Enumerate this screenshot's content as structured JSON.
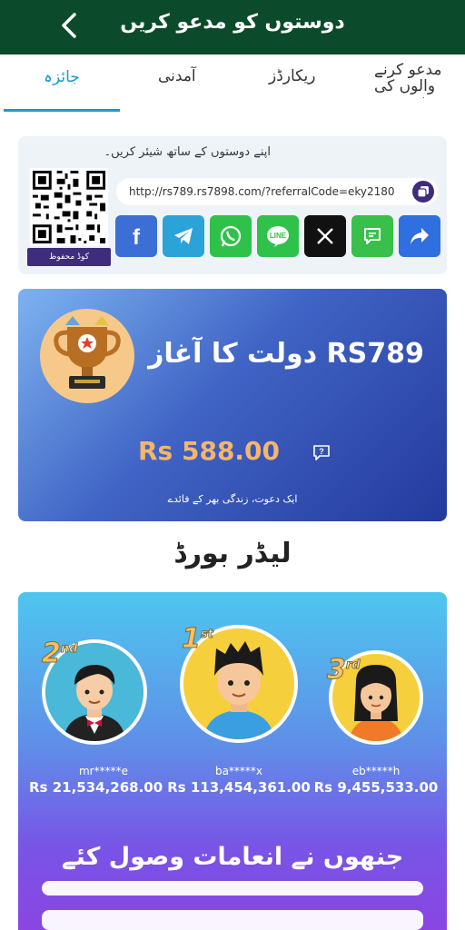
{
  "header": {
    "title": "دوستوں کو مدعو کریں"
  },
  "tabs": [
    {
      "label": "جائزہ"
    },
    {
      "label": "آمدنی"
    },
    {
      "label": "ریکارڈز"
    },
    {
      "label": "مدعو کرنے والوں کی فہرست"
    }
  ],
  "share": {
    "prompt": "اپنے دوستوں کے ساتھ شیئر کریں۔",
    "save_code_label": "کوڈ محفوظ",
    "url": "http://rs789.rs7898.com/?referralCode=eky2180",
    "socials": [
      {
        "name": "facebook",
        "color": "#3b6fd6"
      },
      {
        "name": "telegram",
        "color": "#2aa3d9"
      },
      {
        "name": "whatsapp",
        "color": "#2fc24b"
      },
      {
        "name": "line",
        "color": "#2fc24b"
      },
      {
        "name": "x",
        "color": "#111111"
      },
      {
        "name": "sms",
        "color": "#38c04a"
      },
      {
        "name": "share",
        "color": "#2f6fe0"
      }
    ]
  },
  "promo": {
    "title": "دولت کا آغاز RS789",
    "amount": "Rs  588.00",
    "subtitle": "ایک دعوت، زندگی بھر کے فائدے"
  },
  "leaderboard": {
    "title": "لیڈر بورڈ",
    "entries": [
      {
        "rank": "2",
        "suffix": "nd",
        "name": "mr*****e",
        "amount": "Rs  21,534,268.00"
      },
      {
        "rank": "1",
        "suffix": "st",
        "name": "ba*****x",
        "amount": "Rs  113,454,361.00"
      },
      {
        "rank": "3",
        "suffix": "rd",
        "name": "eb*****h",
        "amount": "Rs  9,455,533.00"
      }
    ],
    "received_title": "جنھوں نے انعامات وصول کئے"
  }
}
